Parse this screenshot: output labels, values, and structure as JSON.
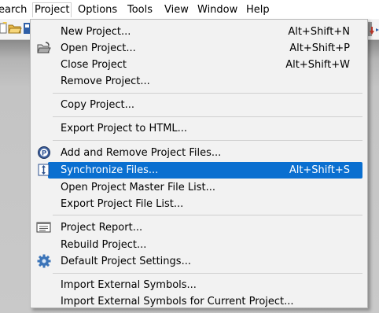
{
  "menubar": {
    "items": [
      {
        "label": "earch"
      },
      {
        "label": "Project"
      },
      {
        "label": "Options"
      },
      {
        "label": "Tools"
      },
      {
        "label": "View"
      },
      {
        "label": "Window"
      },
      {
        "label": "Help"
      }
    ]
  },
  "menu": {
    "items": [
      {
        "label": "New Project...",
        "shortcut": "Alt+Shift+N",
        "icon": null
      },
      {
        "label": "Open Project...",
        "shortcut": "Alt+Shift+P",
        "icon": "open-folder-icon"
      },
      {
        "label": "Close Project",
        "shortcut": "Alt+Shift+W",
        "icon": null
      },
      {
        "label": "Remove Project...",
        "shortcut": "",
        "icon": null
      },
      {
        "label": "Copy Project...",
        "shortcut": "",
        "icon": null
      },
      {
        "label": "Export Project to HTML...",
        "shortcut": "",
        "icon": null
      },
      {
        "label": "Add and Remove Project Files...",
        "shortcut": "",
        "icon": "add-remove-files-icon"
      },
      {
        "label": "Synchronize Files...",
        "shortcut": "Alt+Shift+S",
        "icon": "synchronize-icon",
        "highlighted": true
      },
      {
        "label": "Open Project Master File List...",
        "shortcut": "",
        "icon": null
      },
      {
        "label": "Export Project File List...",
        "shortcut": "",
        "icon": null
      },
      {
        "label": "Project Report...",
        "shortcut": "",
        "icon": "report-icon"
      },
      {
        "label": "Rebuild Project...",
        "shortcut": "",
        "icon": null
      },
      {
        "label": "Default Project Settings...",
        "shortcut": "",
        "icon": "gear-icon"
      },
      {
        "label": "Import External Symbols...",
        "shortcut": "",
        "icon": null
      },
      {
        "label": "Import External Symbols for Current Project...",
        "shortcut": "",
        "icon": null
      }
    ]
  },
  "colors": {
    "highlight": "#0a6fd0",
    "menu_background": "#f2f2f2"
  }
}
